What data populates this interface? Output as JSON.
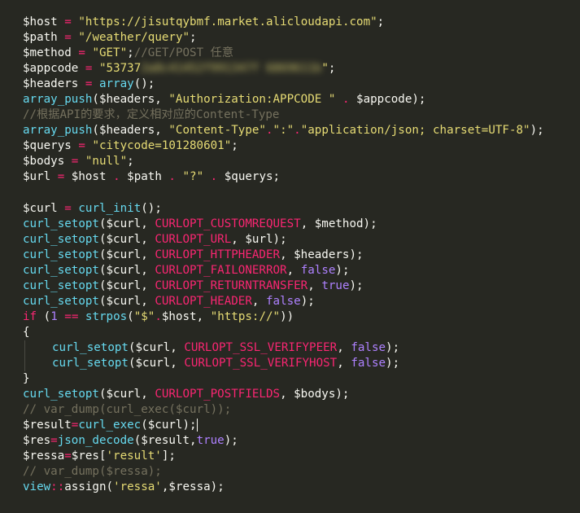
{
  "editor": {
    "lines": [
      {
        "tokens": [
          {
            "t": "var",
            "v": "$host"
          },
          {
            "t": "punc",
            "v": " "
          },
          {
            "t": "op",
            "v": "="
          },
          {
            "t": "punc",
            "v": " "
          },
          {
            "t": "str",
            "v": "\"https://jisutqybmf.market.alicloudapi.com\""
          },
          {
            "t": "punc",
            "v": ";"
          }
        ]
      },
      {
        "tokens": [
          {
            "t": "var",
            "v": "$path"
          },
          {
            "t": "punc",
            "v": " "
          },
          {
            "t": "op",
            "v": "="
          },
          {
            "t": "punc",
            "v": " "
          },
          {
            "t": "str",
            "v": "\"/weather/query\""
          },
          {
            "t": "punc",
            "v": ";"
          }
        ]
      },
      {
        "tokens": [
          {
            "t": "var",
            "v": "$method"
          },
          {
            "t": "punc",
            "v": " "
          },
          {
            "t": "op",
            "v": "="
          },
          {
            "t": "punc",
            "v": " "
          },
          {
            "t": "str",
            "v": "\"GET\""
          },
          {
            "t": "punc",
            "v": ";"
          },
          {
            "t": "comment",
            "v": "//GET/POST 任意"
          }
        ]
      },
      {
        "tokens": [
          {
            "t": "var",
            "v": "$appcode"
          },
          {
            "t": "punc",
            "v": " "
          },
          {
            "t": "op",
            "v": "="
          },
          {
            "t": "punc",
            "v": " "
          },
          {
            "t": "str",
            "v": "\"53737"
          },
          {
            "t": "redact",
            "v": "2a8c41452f991347f 6869611b"
          },
          {
            "t": "str",
            "v": "\""
          },
          {
            "t": "punc",
            "v": ";"
          }
        ]
      },
      {
        "tokens": [
          {
            "t": "var",
            "v": "$headers"
          },
          {
            "t": "punc",
            "v": " "
          },
          {
            "t": "op",
            "v": "="
          },
          {
            "t": "punc",
            "v": " "
          },
          {
            "t": "fn",
            "v": "array"
          },
          {
            "t": "punc",
            "v": "();"
          }
        ]
      },
      {
        "tokens": [
          {
            "t": "fn",
            "v": "array_push"
          },
          {
            "t": "punc",
            "v": "($headers, "
          },
          {
            "t": "str",
            "v": "\"Authorization:APPCODE \""
          },
          {
            "t": "punc",
            "v": " "
          },
          {
            "t": "op",
            "v": "."
          },
          {
            "t": "punc",
            "v": " $appcode);"
          }
        ]
      },
      {
        "tokens": [
          {
            "t": "comment",
            "v": "//根据API的要求，定义相对应的Content-Type"
          }
        ]
      },
      {
        "tokens": [
          {
            "t": "fn",
            "v": "array_push"
          },
          {
            "t": "punc",
            "v": "($headers, "
          },
          {
            "t": "str",
            "v": "\"Content-Type\""
          },
          {
            "t": "op",
            "v": "."
          },
          {
            "t": "str",
            "v": "\":\""
          },
          {
            "t": "op",
            "v": "."
          },
          {
            "t": "str",
            "v": "\"application/json; charset=UTF-8\""
          },
          {
            "t": "punc",
            "v": ");"
          }
        ]
      },
      {
        "tokens": [
          {
            "t": "var",
            "v": "$querys"
          },
          {
            "t": "punc",
            "v": " "
          },
          {
            "t": "op",
            "v": "="
          },
          {
            "t": "punc",
            "v": " "
          },
          {
            "t": "str",
            "v": "\"citycode=101280601\""
          },
          {
            "t": "punc",
            "v": ";"
          }
        ]
      },
      {
        "tokens": [
          {
            "t": "var",
            "v": "$bodys"
          },
          {
            "t": "punc",
            "v": " "
          },
          {
            "t": "op",
            "v": "="
          },
          {
            "t": "punc",
            "v": " "
          },
          {
            "t": "str",
            "v": "\"null\""
          },
          {
            "t": "punc",
            "v": ";"
          }
        ]
      },
      {
        "tokens": [
          {
            "t": "var",
            "v": "$url"
          },
          {
            "t": "punc",
            "v": " "
          },
          {
            "t": "op",
            "v": "="
          },
          {
            "t": "punc",
            "v": " $host "
          },
          {
            "t": "op",
            "v": "."
          },
          {
            "t": "punc",
            "v": " $path "
          },
          {
            "t": "op",
            "v": "."
          },
          {
            "t": "punc",
            "v": " "
          },
          {
            "t": "str",
            "v": "\"?\""
          },
          {
            "t": "punc",
            "v": " "
          },
          {
            "t": "op",
            "v": "."
          },
          {
            "t": "punc",
            "v": " $querys;"
          }
        ]
      },
      {
        "tokens": []
      },
      {
        "tokens": [
          {
            "t": "var",
            "v": "$curl"
          },
          {
            "t": "punc",
            "v": " "
          },
          {
            "t": "op",
            "v": "="
          },
          {
            "t": "punc",
            "v": " "
          },
          {
            "t": "fn",
            "v": "curl_init"
          },
          {
            "t": "punc",
            "v": "();"
          }
        ]
      },
      {
        "tokens": [
          {
            "t": "fn",
            "v": "curl_setopt"
          },
          {
            "t": "punc",
            "v": "($curl, "
          },
          {
            "t": "kw",
            "v": "CURLOPT_CUSTOMREQUEST"
          },
          {
            "t": "punc",
            "v": ", $method);"
          }
        ]
      },
      {
        "tokens": [
          {
            "t": "fn",
            "v": "curl_setopt"
          },
          {
            "t": "punc",
            "v": "($curl, "
          },
          {
            "t": "kw",
            "v": "CURLOPT_URL"
          },
          {
            "t": "punc",
            "v": ", $url);"
          }
        ]
      },
      {
        "tokens": [
          {
            "t": "fn",
            "v": "curl_setopt"
          },
          {
            "t": "punc",
            "v": "($curl, "
          },
          {
            "t": "kw",
            "v": "CURLOPT_HTTPHEADER"
          },
          {
            "t": "punc",
            "v": ", $headers);"
          }
        ]
      },
      {
        "tokens": [
          {
            "t": "fn",
            "v": "curl_setopt"
          },
          {
            "t": "punc",
            "v": "($curl, "
          },
          {
            "t": "kw",
            "v": "CURLOPT_FAILONERROR"
          },
          {
            "t": "punc",
            "v": ", "
          },
          {
            "t": "const",
            "v": "false"
          },
          {
            "t": "punc",
            "v": ");"
          }
        ]
      },
      {
        "tokens": [
          {
            "t": "fn",
            "v": "curl_setopt"
          },
          {
            "t": "punc",
            "v": "($curl, "
          },
          {
            "t": "kw",
            "v": "CURLOPT_RETURNTRANSFER"
          },
          {
            "t": "punc",
            "v": ", "
          },
          {
            "t": "const",
            "v": "true"
          },
          {
            "t": "punc",
            "v": ");"
          }
        ]
      },
      {
        "tokens": [
          {
            "t": "fn",
            "v": "curl_setopt"
          },
          {
            "t": "punc",
            "v": "($curl, "
          },
          {
            "t": "kw",
            "v": "CURLOPT_HEADER"
          },
          {
            "t": "punc",
            "v": ", "
          },
          {
            "t": "const",
            "v": "false"
          },
          {
            "t": "punc",
            "v": ");"
          }
        ]
      },
      {
        "tokens": [
          {
            "t": "kw",
            "v": "if"
          },
          {
            "t": "punc",
            "v": " ("
          },
          {
            "t": "num",
            "v": "1"
          },
          {
            "t": "punc",
            "v": " "
          },
          {
            "t": "op",
            "v": "=="
          },
          {
            "t": "punc",
            "v": " "
          },
          {
            "t": "fn",
            "v": "strpos"
          },
          {
            "t": "punc",
            "v": "("
          },
          {
            "t": "str",
            "v": "\"$\""
          },
          {
            "t": "op",
            "v": "."
          },
          {
            "t": "punc",
            "v": "$host, "
          },
          {
            "t": "str",
            "v": "\"https://\""
          },
          {
            "t": "punc",
            "v": "))"
          }
        ]
      },
      {
        "tokens": [
          {
            "t": "punc",
            "v": "{"
          }
        ]
      },
      {
        "indented": true,
        "tokens": [
          {
            "t": "fn",
            "v": "curl_setopt"
          },
          {
            "t": "punc",
            "v": "($curl, "
          },
          {
            "t": "kw",
            "v": "CURLOPT_SSL_VERIFYPEER"
          },
          {
            "t": "punc",
            "v": ", "
          },
          {
            "t": "const",
            "v": "false"
          },
          {
            "t": "punc",
            "v": ");"
          }
        ]
      },
      {
        "indented": true,
        "tokens": [
          {
            "t": "fn",
            "v": "curl_setopt"
          },
          {
            "t": "punc",
            "v": "($curl, "
          },
          {
            "t": "kw",
            "v": "CURLOPT_SSL_VERIFYHOST"
          },
          {
            "t": "punc",
            "v": ", "
          },
          {
            "t": "const",
            "v": "false"
          },
          {
            "t": "punc",
            "v": ");"
          }
        ]
      },
      {
        "tokens": [
          {
            "t": "punc",
            "v": "}"
          }
        ]
      },
      {
        "tokens": [
          {
            "t": "fn",
            "v": "curl_setopt"
          },
          {
            "t": "punc",
            "v": "($curl, "
          },
          {
            "t": "kw",
            "v": "CURLOPT_POSTFIELDS"
          },
          {
            "t": "punc",
            "v": ", $bodys);"
          }
        ]
      },
      {
        "tokens": [
          {
            "t": "comment",
            "v": "// var_dump(curl_exec($curl));"
          }
        ]
      },
      {
        "cursor_after": true,
        "tokens": [
          {
            "t": "var",
            "v": "$result"
          },
          {
            "t": "op",
            "v": "="
          },
          {
            "t": "fn",
            "v": "curl_exec"
          },
          {
            "t": "punc",
            "v": "($curl);"
          }
        ]
      },
      {
        "tokens": [
          {
            "t": "var",
            "v": "$res"
          },
          {
            "t": "op",
            "v": "="
          },
          {
            "t": "fn",
            "v": "json_decode"
          },
          {
            "t": "punc",
            "v": "($result,"
          },
          {
            "t": "const",
            "v": "true"
          },
          {
            "t": "punc",
            "v": ");"
          }
        ]
      },
      {
        "tokens": [
          {
            "t": "var",
            "v": "$ressa"
          },
          {
            "t": "op",
            "v": "="
          },
          {
            "t": "punc",
            "v": "$res["
          },
          {
            "t": "str",
            "v": "'result'"
          },
          {
            "t": "punc",
            "v": "];"
          }
        ]
      },
      {
        "tokens": [
          {
            "t": "comment",
            "v": "// var_dump($ressa);"
          }
        ]
      },
      {
        "tokens": [
          {
            "t": "fn",
            "v": "view"
          },
          {
            "t": "op",
            "v": "::"
          },
          {
            "t": "punc",
            "v": "assign("
          },
          {
            "t": "str",
            "v": "'ressa'"
          },
          {
            "t": "punc",
            "v": ",$ressa);"
          }
        ]
      }
    ]
  },
  "colors": {
    "background": "#272822",
    "variable": "#f8f8f2",
    "operator": "#f92672",
    "string": "#e6db74",
    "function": "#66d9ef",
    "constant": "#ae81ff",
    "comment": "#75715e"
  }
}
